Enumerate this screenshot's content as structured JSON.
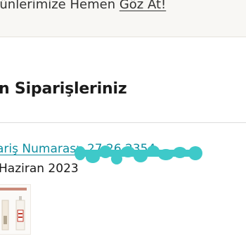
{
  "promo": {
    "text": "rünlerimize Hemen ",
    "link_label": "Göz At!"
  },
  "orders": {
    "title": "n Siparişleriniz",
    "items": [
      {
        "number_label": "ariş Numarası: 27 26 2354",
        "date": "Haziran 2023"
      }
    ]
  },
  "colors": {
    "link": "#0f8ea0",
    "redaction": "#3ec9c9",
    "promo_background": "#f8f7f4"
  }
}
